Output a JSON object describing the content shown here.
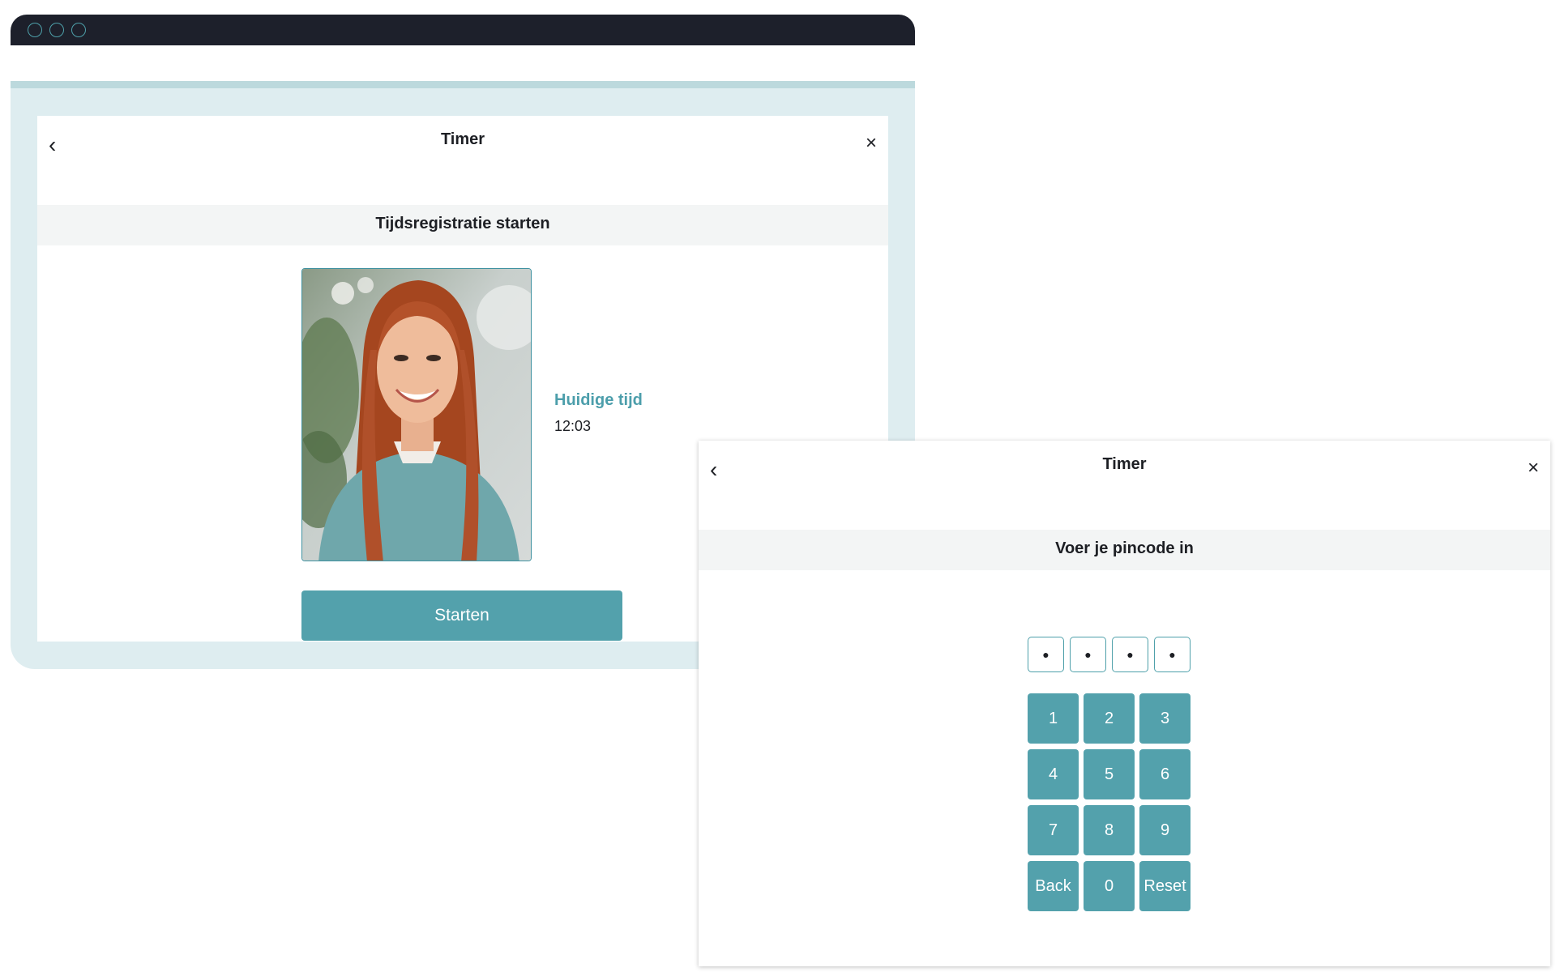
{
  "window": {
    "controls": [
      "close",
      "minimize",
      "maximize"
    ]
  },
  "timer_card": {
    "title": "Timer",
    "back_icon": "‹",
    "close_icon": "×",
    "section_title": "Tijdsregistratie starten",
    "current_time_label": "Huidige tijd",
    "current_time_value": "12:03",
    "start_button": "Starten"
  },
  "pin_modal": {
    "title": "Timer",
    "back_icon": "‹",
    "close_icon": "×",
    "section_title": "Voer je pincode in",
    "pin_dots": [
      "●",
      "●",
      "●",
      "●"
    ],
    "keys": [
      "1",
      "2",
      "3",
      "4",
      "5",
      "6",
      "7",
      "8",
      "9",
      "Back",
      "0",
      "Reset"
    ]
  },
  "colors": {
    "accent": "#53a1ac",
    "titlebar": "#1d202b",
    "panel_bg": "#deedf0",
    "label_accent": "#4c9eab"
  }
}
